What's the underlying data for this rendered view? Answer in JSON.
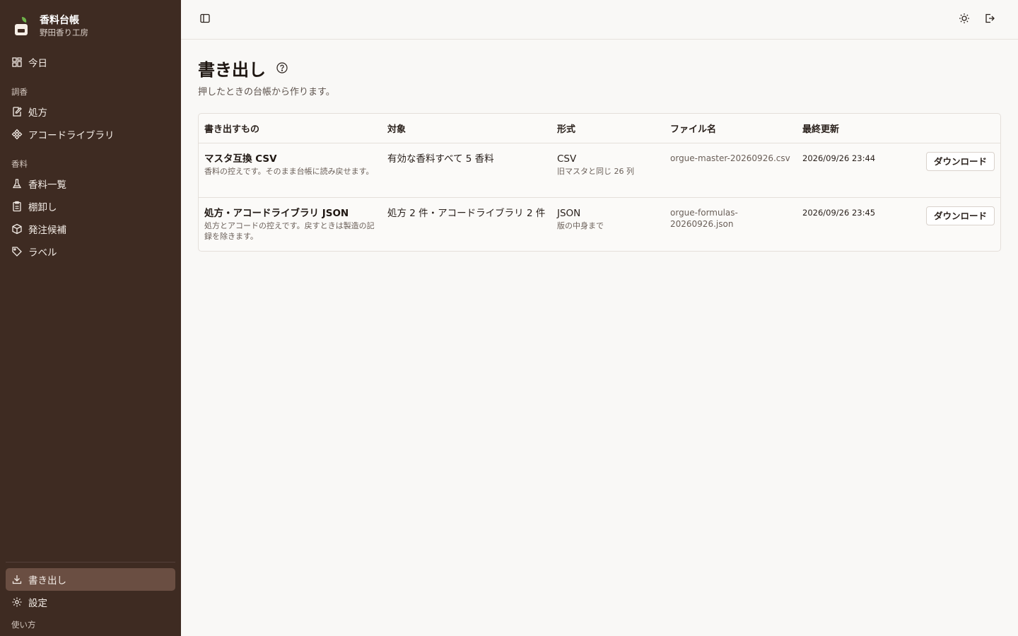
{
  "brand": {
    "title": "香料台帳",
    "subtitle": "野田香り工房"
  },
  "nav": {
    "today": "今日",
    "section_blend": "調香",
    "formulas": "処方",
    "accords": "アコードライブラリ",
    "section_materials": "香料",
    "materials": "香料一覧",
    "inventory": "棚卸し",
    "orders": "発注候補",
    "labels": "ラベル",
    "export": "書き出し",
    "settings": "設定",
    "help": "使い方"
  },
  "page": {
    "title": "書き出し",
    "subtitle": "押したときの台帳から作ります。"
  },
  "table": {
    "headers": [
      "書き出すもの",
      "対象",
      "形式",
      "ファイル名",
      "最終更新"
    ],
    "rows": [
      {
        "title": "マスタ互換 CSV",
        "desc": "香料の控えです。そのまま台帳に読み戻せます。",
        "target": "有効な香料すべて 5 香料",
        "format": "CSV",
        "format_note": "旧マスタと同じ 26 列",
        "filename": "orgue-master-20260926.csv",
        "updated": "2026/09/26 23:44",
        "action": "ダウンロード"
      },
      {
        "title": "処方・アコードライブラリ JSON",
        "desc": "処方とアコードの控えです。戻すときは製造の記録を除きます。",
        "target": "処方 2 件・アコードライブラリ 2 件",
        "format": "JSON",
        "format_note": "版の中身まで",
        "filename": "orgue-formulas-20260926.json",
        "updated": "2026/09/26 23:45",
        "action": "ダウンロード"
      }
    ]
  },
  "colors": {
    "sidebar_bg": "#3e2b22",
    "active_item": "#6a4e42",
    "page_bg": "#f9f8f6"
  },
  "icons": [
    "dashboard-icon",
    "edit-note-icon",
    "diamond-icon",
    "flask-icon",
    "clipboard-icon",
    "package-icon",
    "tag-icon",
    "download-icon",
    "gear-icon",
    "sidebar-toggle-icon",
    "sun-icon",
    "logout-icon",
    "help-circle-icon"
  ]
}
